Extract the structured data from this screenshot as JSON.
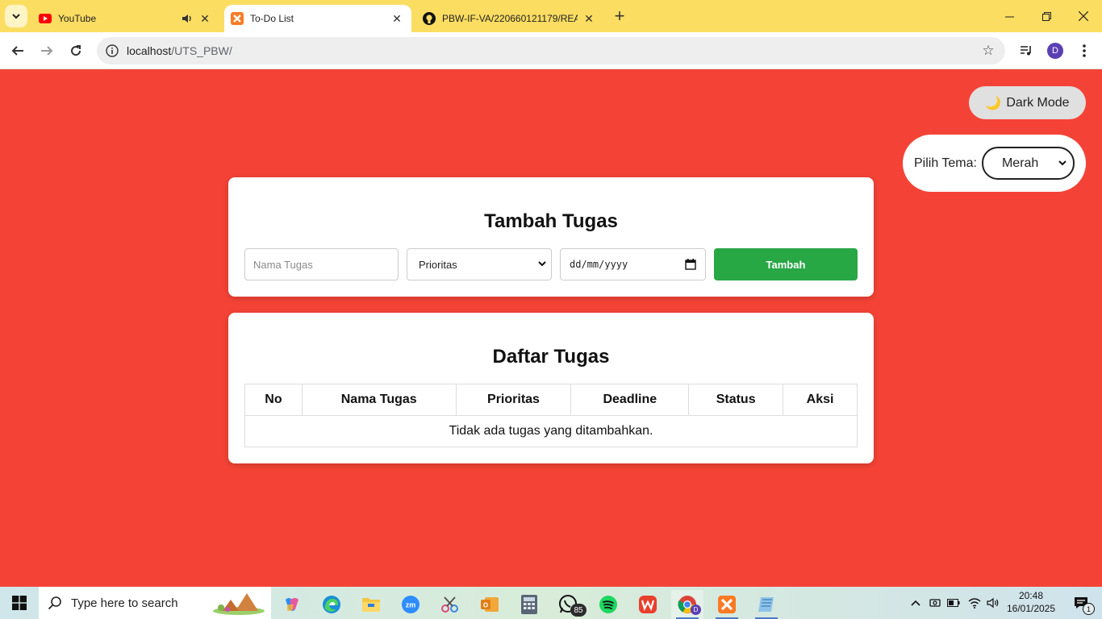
{
  "browser": {
    "tabs": [
      {
        "title": "YouTube",
        "icon": "youtube-icon",
        "audio": true
      },
      {
        "title": "To-Do List",
        "icon": "xampp-icon",
        "active": true
      },
      {
        "title": "PBW-IF-VA/220660121179/REA",
        "icon": "github-icon"
      }
    ],
    "url_host": "localhost",
    "url_path": "/UTS_PBW/",
    "profile_initial": "D"
  },
  "page": {
    "dark_mode_label": "Dark Mode",
    "dark_mode_emoji": "🌙",
    "theme_label": "Pilih Tema:",
    "theme_selected": "Merah",
    "add_section_title": "Tambah Tugas",
    "task_placeholder": "Nama Tugas",
    "priority_selected": "Prioritas",
    "date_placeholder": "dd/mm/yyyy",
    "add_button": "Tambah",
    "list_section_title": "Daftar Tugas",
    "table_headers": [
      "No",
      "Nama Tugas",
      "Prioritas",
      "Deadline",
      "Status",
      "Aksi"
    ],
    "empty_message": "Tidak ada tugas yang ditambahkan.",
    "theme_color": "#f44336",
    "add_button_color": "#28a745"
  },
  "taskbar": {
    "search_placeholder": "Type here to search",
    "whatsapp_badge": "85",
    "time": "20:48",
    "date": "16/01/2025",
    "notification_count": "1"
  }
}
